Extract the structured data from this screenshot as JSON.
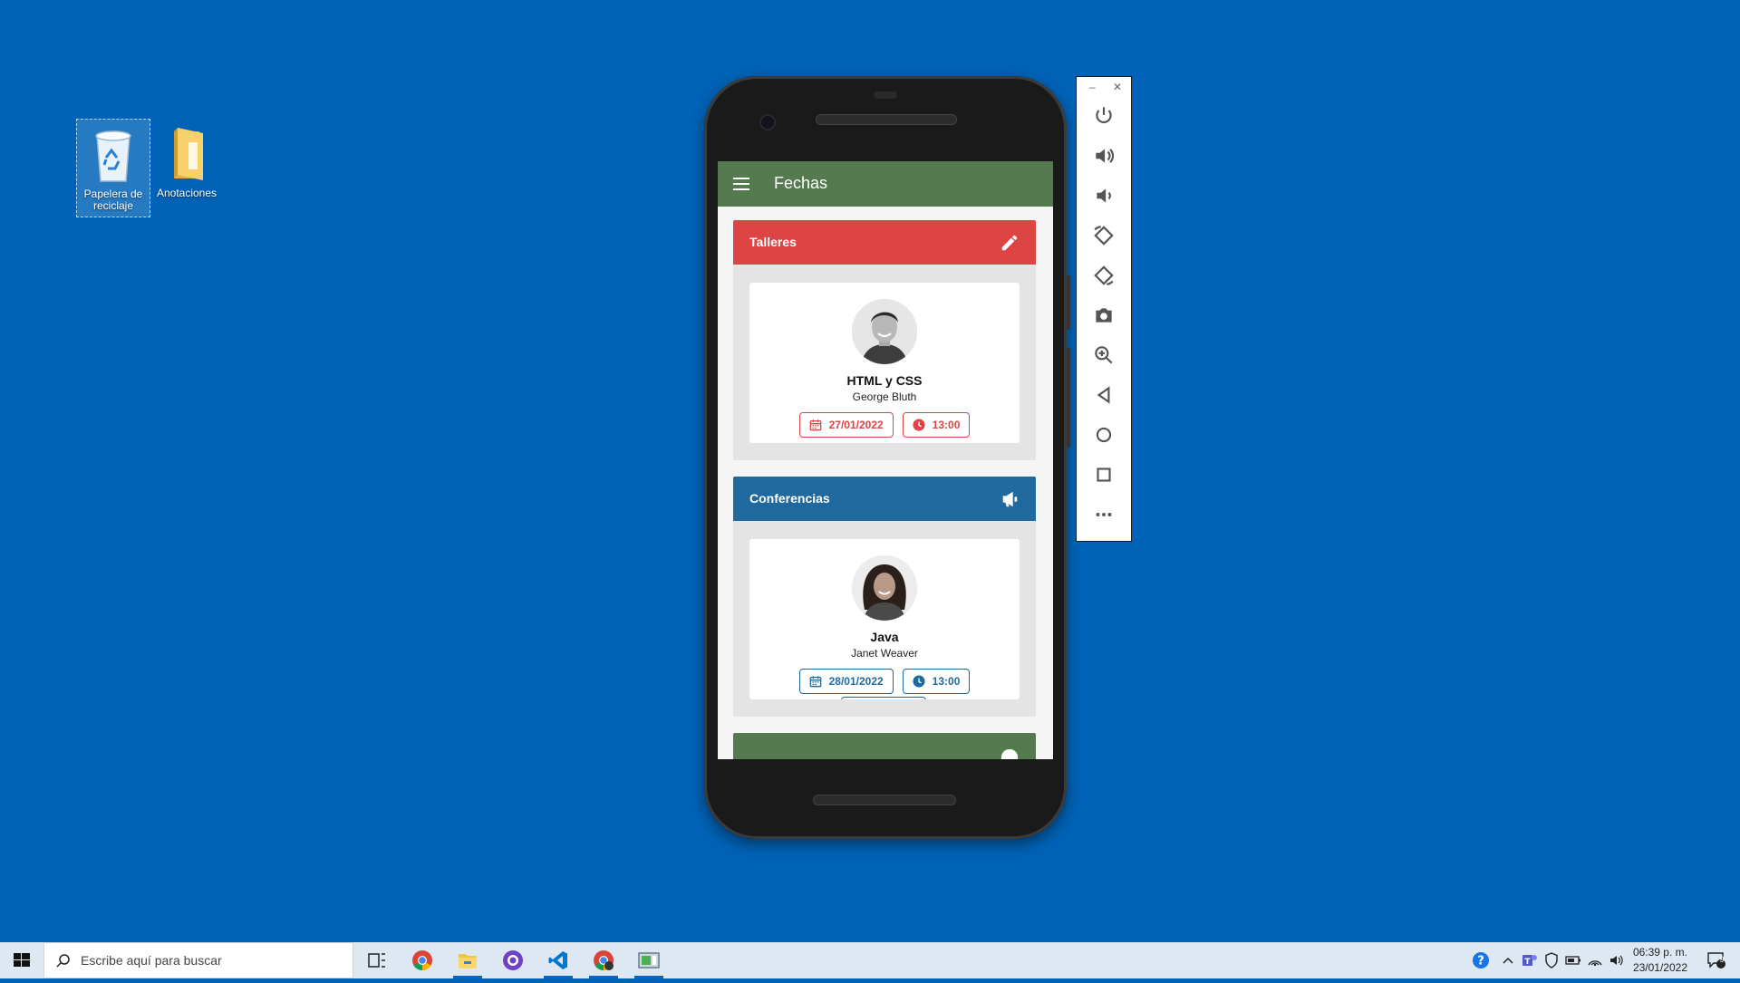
{
  "desktop": {
    "icons": [
      {
        "label": "Papelera de reciclaje"
      },
      {
        "label": "Anotaciones"
      }
    ]
  },
  "app": {
    "title": "Fechas",
    "sections": [
      {
        "header": "Talleres",
        "color": "#dd4444",
        "icon": "pencil-icon",
        "card": {
          "title": "HTML y CSS",
          "speaker": "George Bluth",
          "date": "27/01/2022",
          "time": "13:00"
        }
      },
      {
        "header": "Conferencias",
        "color": "#20699e",
        "icon": "megaphone-icon",
        "card": {
          "title": "Java",
          "speaker": "Janet Weaver",
          "date": "28/01/2022",
          "time": "13:00"
        }
      },
      {
        "header": "",
        "color": "#557a4f",
        "icon": "info-icon"
      }
    ]
  },
  "emulator": {
    "tools": [
      "power-icon",
      "volume-up-icon",
      "volume-down-icon",
      "rotate-left-icon",
      "rotate-right-icon",
      "camera-icon",
      "zoom-icon",
      "back-icon",
      "home-icon",
      "overview-icon",
      "more-icon"
    ]
  },
  "taskbar": {
    "search_placeholder": "Escribe aquí para buscar",
    "apps": [
      "task-view-icon",
      "chrome-icon",
      "file-explorer-icon",
      "github-desktop-icon",
      "vscode-icon",
      "chrome-profile-icon",
      "emulator-icon"
    ],
    "time": "06:39 p. m.",
    "date": "23/01/2022",
    "notifications": "9"
  }
}
